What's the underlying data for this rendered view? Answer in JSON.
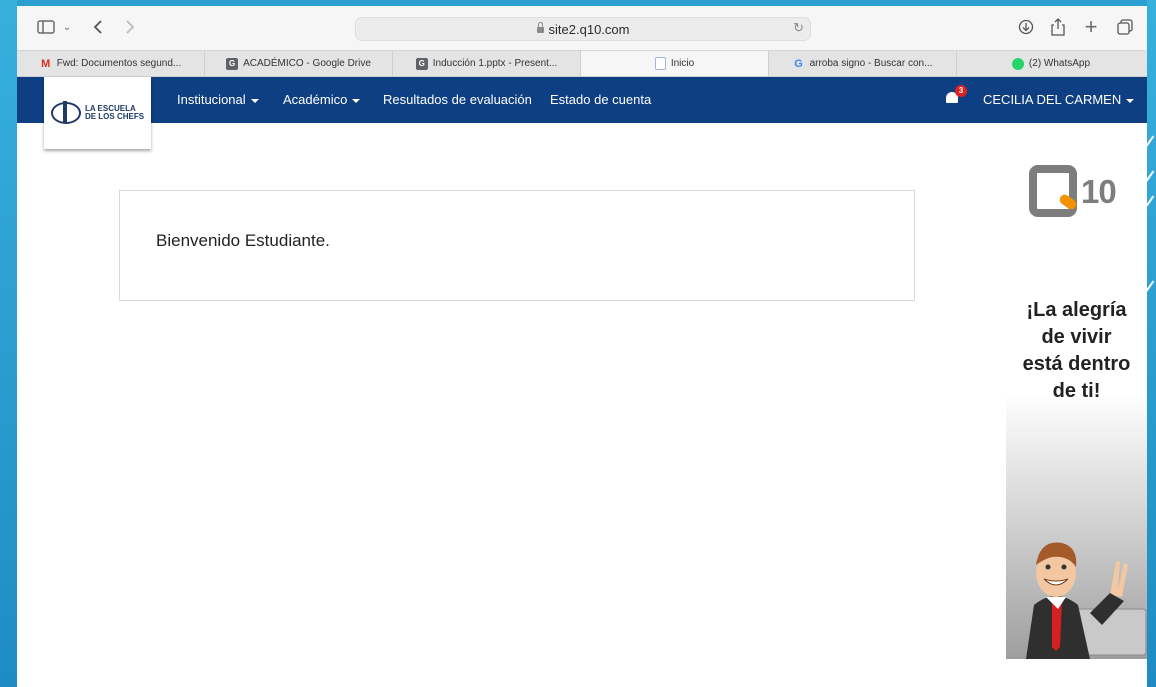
{
  "browser": {
    "url": "site2.q10.com",
    "tabs": [
      {
        "label": "Fwd: Documentos segund...",
        "icon": "gmail-icon",
        "color": "#d93025"
      },
      {
        "label": "ACADÉMICO - Google Drive",
        "icon": "g-tab-icon",
        "color": "#5f6368"
      },
      {
        "label": "Inducción 1.pptx - Present...",
        "icon": "g-tab-icon",
        "color": "#5f6368"
      },
      {
        "label": "Inicio",
        "icon": "page-icon",
        "color": "#9fb6d6"
      },
      {
        "label": "arroba signo - Buscar con...",
        "icon": "google-icon",
        "color": "#4285f4"
      },
      {
        "label": "(2) WhatsApp",
        "icon": "whatsapp-icon",
        "color": "#25d366"
      }
    ]
  },
  "nav": {
    "logo_line1": "LA ESCUELA",
    "logo_line2": "DE LOS CHEFS",
    "items": [
      "Institucional",
      "Académico",
      "Resultados de evaluación",
      "Estado de cuenta"
    ],
    "notification_count": "3",
    "user": "CECILIA DEL CARMEN",
    "color": "#0e3f82"
  },
  "main": {
    "welcome": "Bienvenido Estudiante."
  },
  "sidebar": {
    "brand": "10",
    "ad_text": [
      "¡La alegría",
      "de vivir",
      "está dentro",
      "de ti!"
    ]
  }
}
